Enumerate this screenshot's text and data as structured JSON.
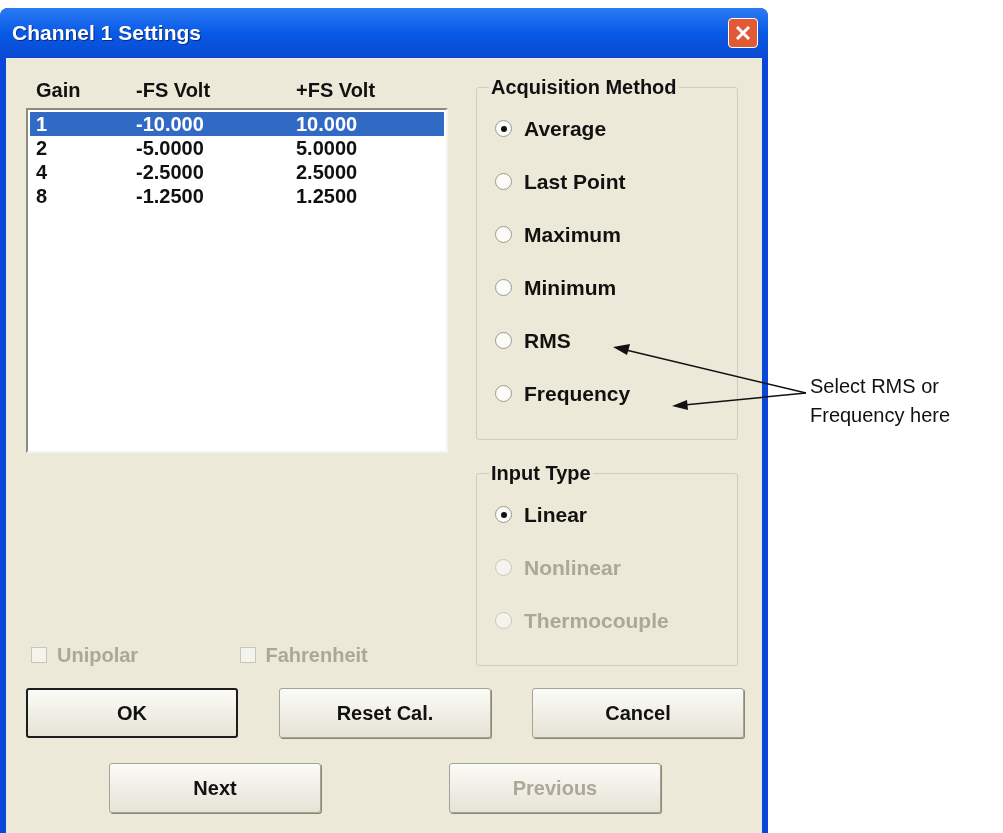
{
  "window": {
    "title": "Channel 1 Settings"
  },
  "gain_list": {
    "columns": [
      "Gain",
      "-FS Volt",
      "+FS Volt"
    ],
    "rows": [
      {
        "cells": [
          "1",
          "-10.000",
          "10.000"
        ],
        "selected": true
      },
      {
        "cells": [
          "2",
          "-5.0000",
          "5.0000"
        ],
        "selected": false
      },
      {
        "cells": [
          "4",
          "-2.5000",
          "2.5000"
        ],
        "selected": false
      },
      {
        "cells": [
          "8",
          "-1.2500",
          "1.2500"
        ],
        "selected": false
      }
    ]
  },
  "acquisition_method": {
    "title": "Acquisition Method",
    "options": [
      {
        "label": "Average",
        "selected": true,
        "disabled": false
      },
      {
        "label": "Last Point",
        "selected": false,
        "disabled": false
      },
      {
        "label": "Maximum",
        "selected": false,
        "disabled": false
      },
      {
        "label": "Minimum",
        "selected": false,
        "disabled": false
      },
      {
        "label": "RMS",
        "selected": false,
        "disabled": false
      },
      {
        "label": "Frequency",
        "selected": false,
        "disabled": false
      }
    ]
  },
  "input_type": {
    "title": "Input Type",
    "options": [
      {
        "label": "Linear",
        "selected": true,
        "disabled": false
      },
      {
        "label": "Nonlinear",
        "selected": false,
        "disabled": true
      },
      {
        "label": "Thermocouple",
        "selected": false,
        "disabled": true
      }
    ]
  },
  "checkboxes": [
    {
      "label": "Unipolar",
      "checked": false,
      "disabled": true
    },
    {
      "label": "Fahrenheit",
      "checked": false,
      "disabled": true
    }
  ],
  "button_rows": [
    [
      {
        "label": "OK",
        "default": true,
        "disabled": false
      },
      {
        "label": "Reset Cal.",
        "default": false,
        "disabled": false
      },
      {
        "label": "Cancel",
        "default": false,
        "disabled": false
      }
    ],
    [
      {
        "label": "Next",
        "default": false,
        "disabled": false
      },
      {
        "label": "Previous",
        "default": false,
        "disabled": true
      }
    ]
  ],
  "annotation": {
    "text": "Select RMS or Frequency here"
  }
}
